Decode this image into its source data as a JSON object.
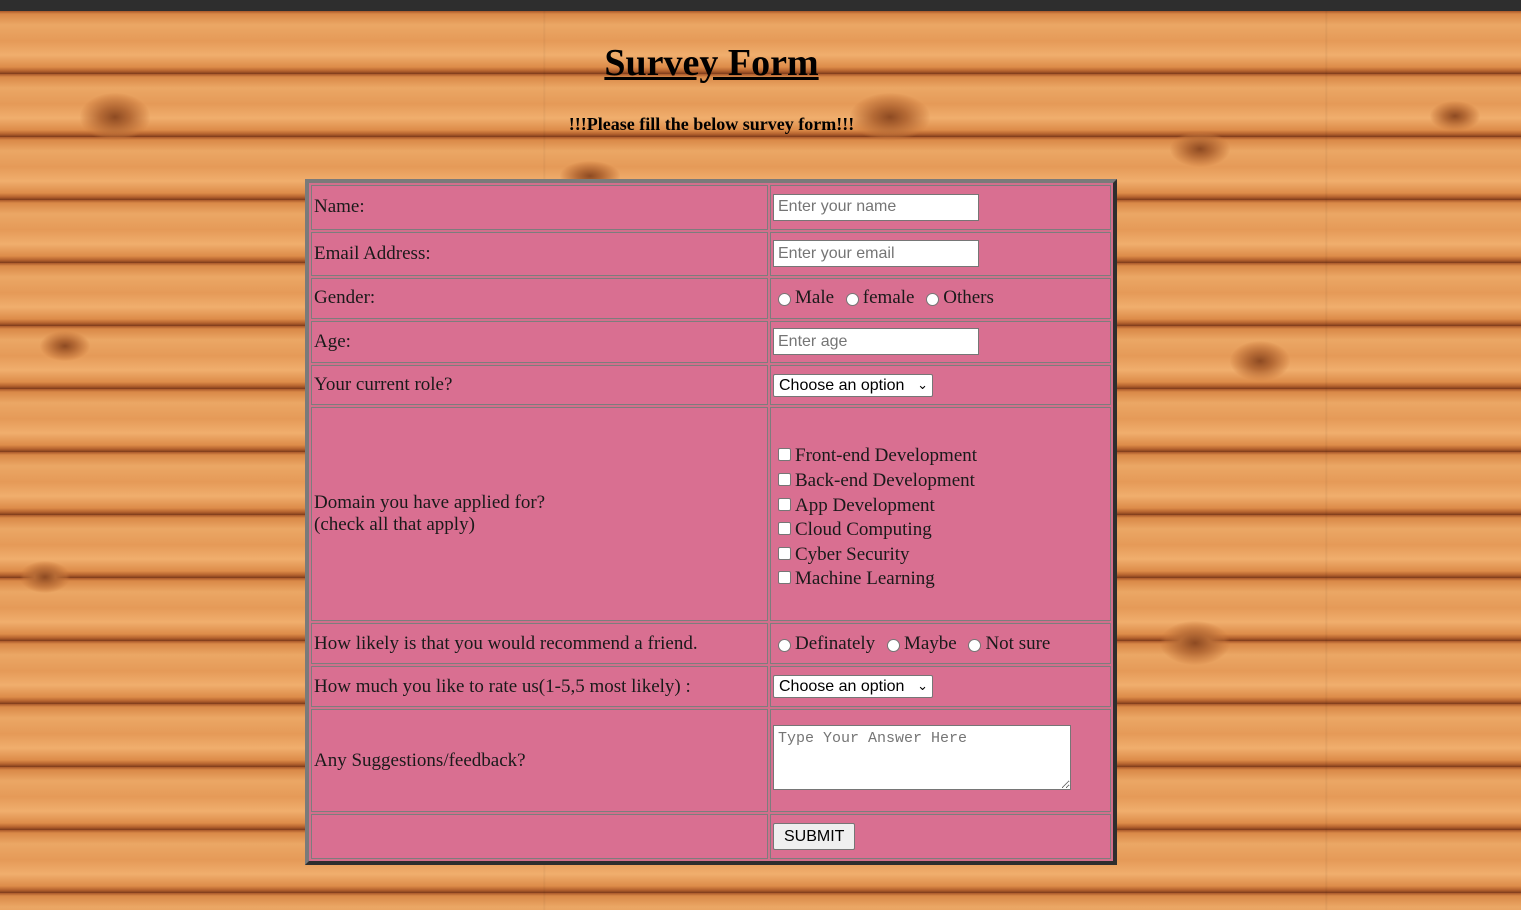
{
  "page": {
    "title": "Survey Form",
    "subtitle": "!!!Please fill the below survey form!!!"
  },
  "form": {
    "name_label": "Name:",
    "name_placeholder": "Enter your name",
    "email_label": "Email Address:",
    "email_placeholder": "Enter your email",
    "gender_label": "Gender:",
    "gender_options": [
      "Male",
      "female",
      "Others"
    ],
    "age_label": "Age:",
    "age_placeholder": "Enter age",
    "role_label": "Your current role?",
    "role_selected": "Choose an option",
    "domain_label_line1": "Domain you have applied for?",
    "domain_label_line2": "(check all that apply)",
    "domain_options": [
      "Front-end Development",
      "Back-end Development",
      "App Development",
      "Cloud Computing",
      "Cyber Security",
      "Machine Learning"
    ],
    "recommend_label": "How likely is that you would recommend a friend.",
    "recommend_options": [
      "Definately",
      "Maybe",
      "Not sure"
    ],
    "rate_label": "How much you like to rate us(1-5,5 most likely) :",
    "rate_selected": "Choose an option",
    "feedback_label": "Any Suggestions/feedback?",
    "feedback_placeholder": "Type Your Answer Here",
    "submit_label": "SUBMIT"
  },
  "icons": {
    "select_chevron": "chevron-down-icon"
  }
}
